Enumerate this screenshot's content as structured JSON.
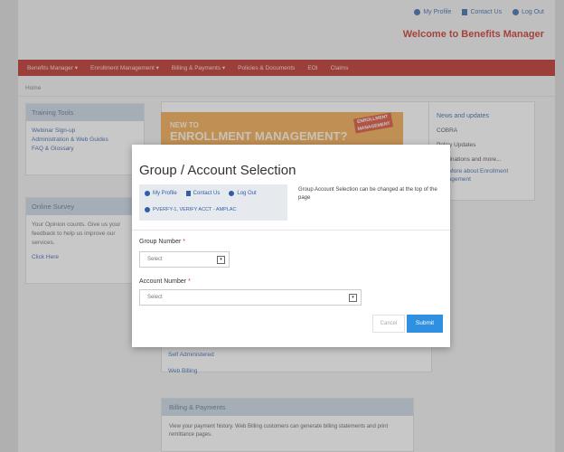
{
  "header": {
    "links": [
      "My Profile",
      "Contact Us",
      "Log Out"
    ],
    "welcome": "Welcome to Benefits Manager"
  },
  "nav": {
    "items": [
      "Benefits Manager ▾",
      "Enrollment Management ▾",
      "Billing & Payments ▾",
      "Policies & Documents",
      "EOI",
      "Claims"
    ]
  },
  "breadcrumb": "Home",
  "training": {
    "title": "Training Tools",
    "links": [
      "Webinar Sign-up",
      "Administration & Web Guides",
      "FAQ & Glossary"
    ]
  },
  "survey": {
    "title": "Online Survey",
    "text": "Your Opinion counts. Give us your feedback to help us improve our services.",
    "link": "Click Here"
  },
  "promo": {
    "line1": "NEW TO",
    "line2": "ENROLLMENT MANAGEMENT?",
    "sticker": "ENROLLMENT MANAGEMENT"
  },
  "center_links": [
    "Self Administered",
    "Web Billing"
  ],
  "billing": {
    "title": "Billing & Payments",
    "text": "View your payment history. Web Billing customers can generate billing statements and print remittance pages."
  },
  "news": {
    "title": "News and updates",
    "items": [
      "COBRA",
      "Policy Updates",
      "Terminations and more..."
    ],
    "link": "See More about Enrollment Management"
  },
  "modal": {
    "title": "Group / Account Selection",
    "links": [
      "My Profile",
      "Contact Us",
      "Log Out"
    ],
    "user": "PVERFY-1, VERIFY ACCT - AMPLAC",
    "note": "Group Account Selection can be changed at the top of the page",
    "group_label": "Group Number",
    "group_value": "Select",
    "account_label": "Account Number",
    "account_value": "Select",
    "required_mark": "*",
    "cancel_label": "Cancel",
    "submit_label": "Submit"
  },
  "colors": {
    "nav_bg": "#b8231a",
    "welcome": "#c8281c",
    "link": "#2f5fa8",
    "submit": "#2f8fe0"
  }
}
